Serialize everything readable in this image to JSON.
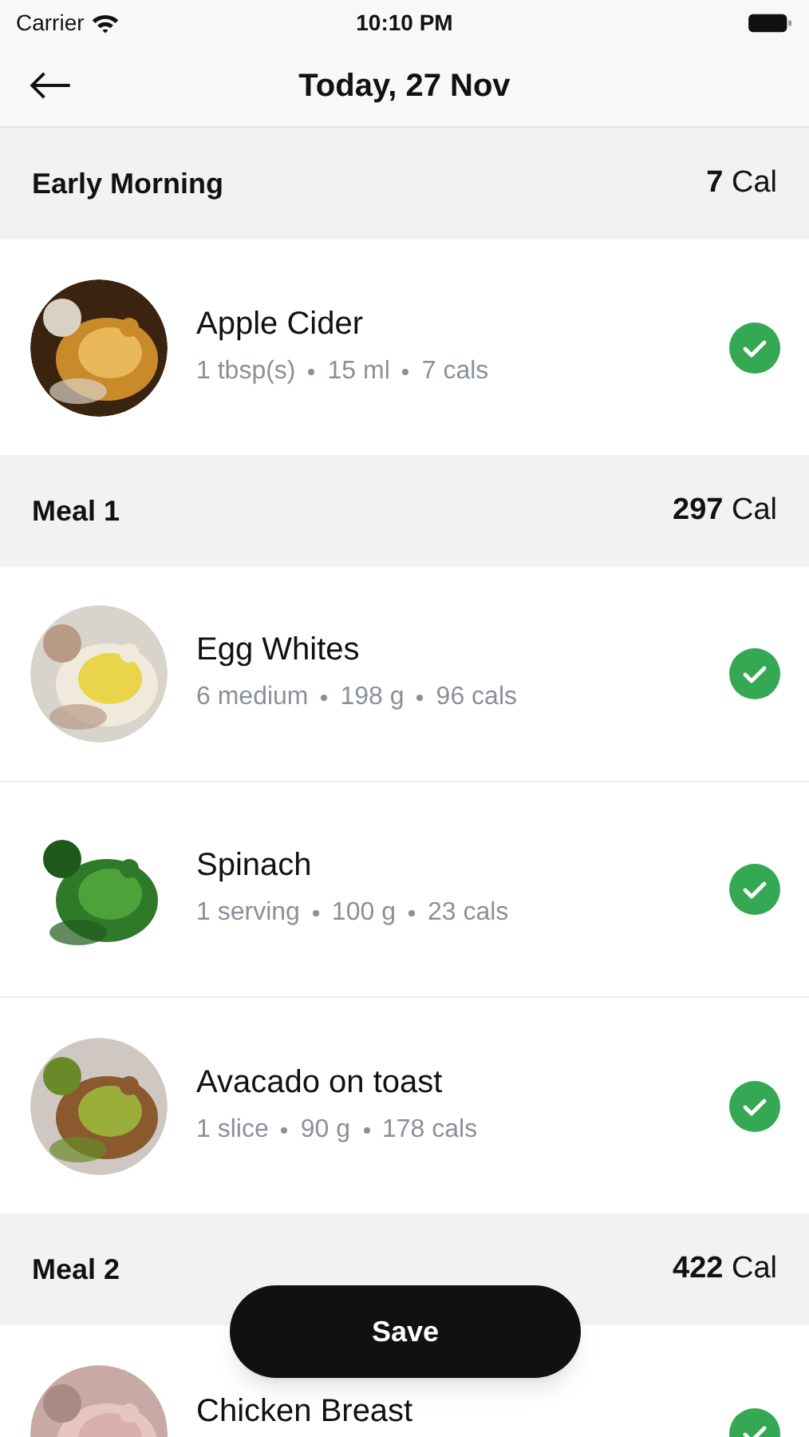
{
  "status_bar": {
    "carrier": "Carrier",
    "time": "10:10 PM"
  },
  "header": {
    "title": "Today, 27 Nov"
  },
  "sections": [
    {
      "title": "Early Morning",
      "total": "7",
      "unit": "Cal",
      "items": [
        {
          "name": "Apple Cider",
          "parts": [
            "1 tbsp(s)",
            "15 ml",
            "7 cals"
          ],
          "checked": true
        }
      ]
    },
    {
      "title": "Meal 1",
      "total": "297",
      "unit": "Cal",
      "items": [
        {
          "name": "Egg Whites",
          "parts": [
            "6 medium",
            "198 g",
            "96 cals"
          ],
          "checked": true
        },
        {
          "name": "Spinach",
          "parts": [
            "1 serving",
            "100 g",
            "23 cals"
          ],
          "checked": true
        },
        {
          "name": "Avacado on toast",
          "parts": [
            "1 slice",
            "90 g",
            "178 cals"
          ],
          "checked": true
        }
      ]
    },
    {
      "title": "Meal 2",
      "total": "422",
      "unit": "Cal",
      "items": [
        {
          "name": "Chicken Breast",
          "checked": true
        }
      ]
    }
  ],
  "save_button": "Save"
}
